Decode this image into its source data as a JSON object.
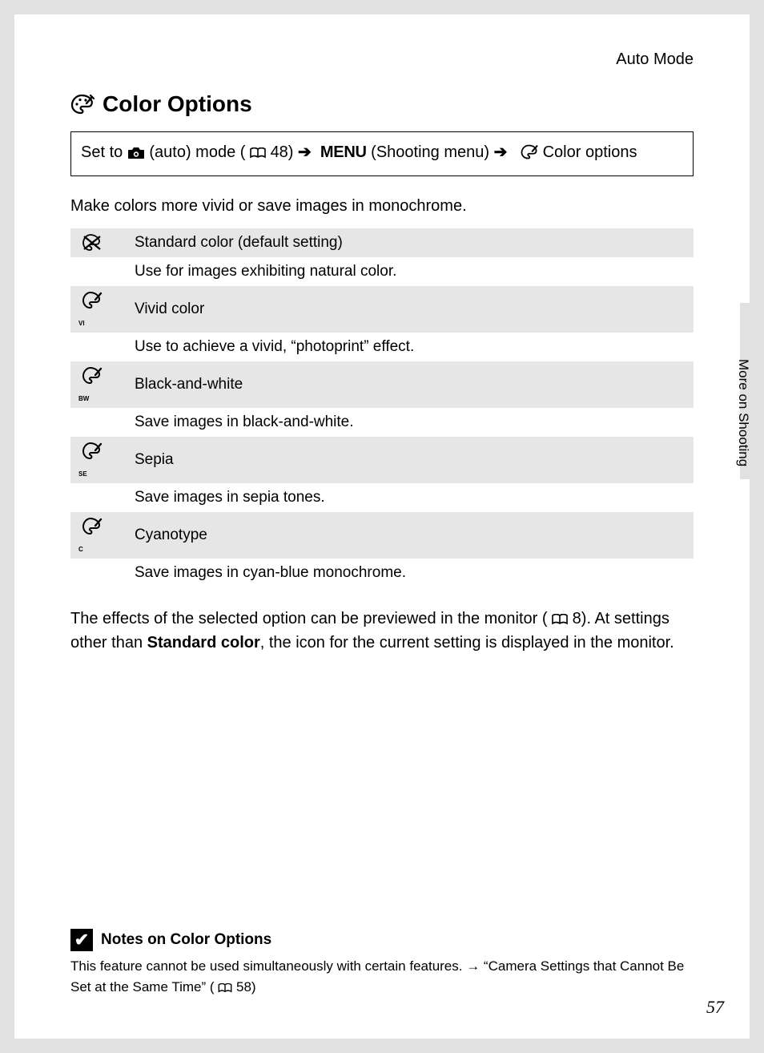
{
  "header": {
    "label": "Auto Mode"
  },
  "title": "Color Options",
  "breadcrumb": {
    "prefix": "Set to ",
    "auto_mode": " (auto) mode (",
    "page_ref_1": " 48) ",
    "menu_word": "MENU",
    "shooting_menu": " (Shooting menu) ",
    "color_options": " Color options"
  },
  "intro": "Make colors more vivid or save images in monochrome.",
  "options": [
    {
      "title": "Standard color (default setting)",
      "desc": "Use for images exhibiting natural color.",
      "sub": ""
    },
    {
      "title": "Vivid color",
      "desc": "Use to achieve a vivid, “photoprint” effect.",
      "sub": "VI"
    },
    {
      "title": "Black-and-white",
      "desc": "Save images in black-and-white.",
      "sub": "BW"
    },
    {
      "title": "Sepia",
      "desc": "Save images in sepia tones.",
      "sub": "SE"
    },
    {
      "title": "Cyanotype",
      "desc": "Save images in cyan-blue monochrome.",
      "sub": "C"
    }
  ],
  "paragraph": {
    "p1a": "The effects of the selected option can be previewed in the monitor (",
    "p1_ref": " 8). At settings other than ",
    "bold": "Standard color",
    "p1b": ", the icon for the current setting is displayed in the monitor."
  },
  "side_label": "More on Shooting",
  "notes": {
    "title": "Notes on Color Options",
    "body_a": "This feature cannot be used simultaneously with certain features. → “Camera Settings that Cannot Be Set at the Same Time” (",
    "body_ref": " 58)"
  },
  "page_number": "57"
}
